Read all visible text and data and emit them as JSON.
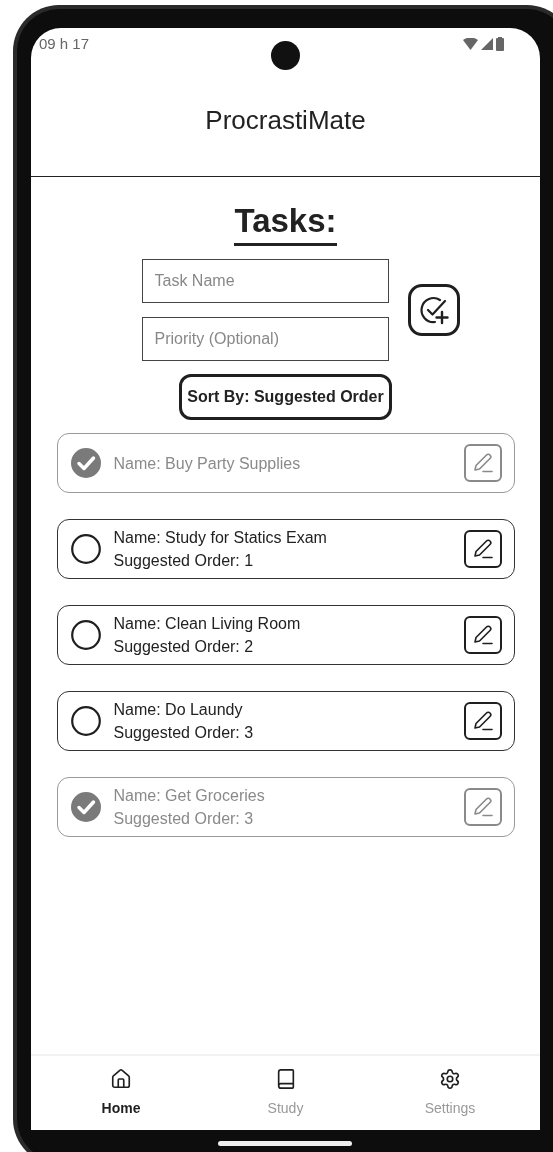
{
  "status_bar": {
    "time": "09 h 17"
  },
  "app_bar": {
    "title": "ProcrastiMate"
  },
  "heading": "Tasks:",
  "form": {
    "fields": [
      {
        "placeholder": "Task Name"
      },
      {
        "placeholder": "Priority (Optional)"
      }
    ]
  },
  "sort_button": "Sort By: Suggested Order",
  "tasks": [
    {
      "name": "Name: Buy Party Supplies",
      "done": true
    },
    {
      "name": "Name: Study for Statics Exam",
      "order": "Suggested Order: 1",
      "done": false
    },
    {
      "name": "Name: Clean Living Room",
      "order": "Suggested Order: 2",
      "done": false
    },
    {
      "name": "Name: Do Laundy",
      "order": "Suggested Order: 3",
      "done": false
    },
    {
      "name": "Name: Get Groceries",
      "order": "Suggested Order: 3",
      "done": true
    }
  ],
  "bottom_nav": [
    {
      "kind": "home",
      "label": "Home",
      "selected": true
    },
    {
      "kind": "study",
      "label": "Study",
      "selected": false
    },
    {
      "kind": "settings",
      "label": "Settings",
      "selected": false
    }
  ]
}
